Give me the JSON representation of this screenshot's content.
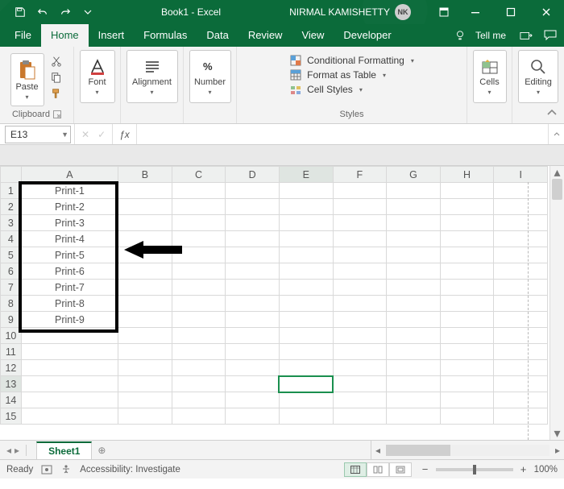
{
  "title": {
    "document": "Book1",
    "app": "Excel",
    "combined": "Book1  -  Excel"
  },
  "user": {
    "name": "NIRMAL KAMISHETTY",
    "initials": "NK"
  },
  "tabs": {
    "file": "File",
    "items": [
      "Home",
      "Insert",
      "Formulas",
      "Data",
      "Review",
      "View",
      "Developer"
    ],
    "active": "Home",
    "tellme": "Tell me"
  },
  "ribbon": {
    "clipboard": {
      "paste": "Paste",
      "label": "Clipboard"
    },
    "font": {
      "btn": "Font",
      "label": ""
    },
    "alignment": {
      "btn": "Alignment",
      "label": ""
    },
    "number": {
      "btn": "Number",
      "label": ""
    },
    "styles": {
      "cond": "Conditional Formatting",
      "table": "Format as Table",
      "cell": "Cell Styles",
      "label": "Styles"
    },
    "cells": {
      "btn": "Cells",
      "label": ""
    },
    "editing": {
      "btn": "Editing",
      "label": ""
    }
  },
  "formula_bar": {
    "namebox": "E13",
    "formula": ""
  },
  "columns": [
    "A",
    "B",
    "C",
    "D",
    "E",
    "F",
    "G",
    "H",
    "I"
  ],
  "rows_visible": 15,
  "selected_cell": {
    "col": "E",
    "row": 13
  },
  "sheet": {
    "active": "Sheet1"
  },
  "status": {
    "ready": "Ready",
    "accessibility": "Accessibility: Investigate",
    "zoom": "100%"
  },
  "cell_data": {
    "A": [
      "Print-1",
      "Print-2",
      "Print-3",
      "Print-4",
      "Print-5",
      "Print-6",
      "Print-7",
      "Print-8",
      "Print-9"
    ]
  }
}
